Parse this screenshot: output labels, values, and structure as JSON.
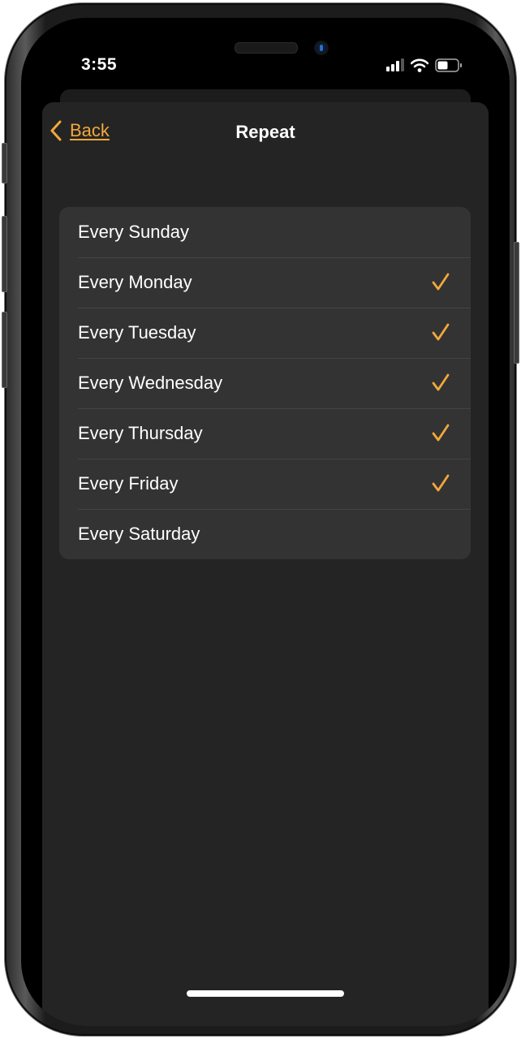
{
  "status_bar": {
    "time": "3:55",
    "icons": [
      "cellular-signal-icon",
      "wifi-icon",
      "battery-icon"
    ]
  },
  "nav": {
    "back_label": "Back",
    "back_icon": "chevron-left-icon",
    "title": "Repeat"
  },
  "accent_color": "#f2a83b",
  "repeat_options": [
    {
      "label": "Every Sunday",
      "checked": false
    },
    {
      "label": "Every Monday",
      "checked": true
    },
    {
      "label": "Every Tuesday",
      "checked": true
    },
    {
      "label": "Every Wednesday",
      "checked": true
    },
    {
      "label": "Every Thursday",
      "checked": true
    },
    {
      "label": "Every Friday",
      "checked": true
    },
    {
      "label": "Every Saturday",
      "checked": false
    }
  ]
}
